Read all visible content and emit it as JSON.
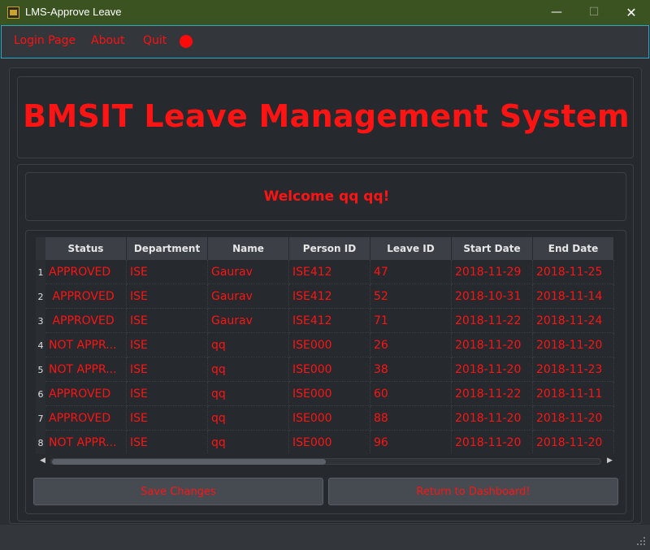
{
  "window": {
    "title": "LMS-Approve Leave",
    "minimize_glyph": "—",
    "maximize_glyph": "☐",
    "close_glyph": "✕"
  },
  "menu": {
    "items": [
      "Login Page",
      "About",
      "Quit"
    ],
    "indicator_color": "#ff0a0a"
  },
  "banner": {
    "title": "BMSIT Leave Management System"
  },
  "welcome": {
    "text": "Welcome qq qq!"
  },
  "table": {
    "columns": [
      "Status",
      "Department",
      "Name",
      "Person ID",
      "Leave ID",
      "Start Date",
      "End Date"
    ],
    "rows": [
      {
        "num": "1",
        "status": "APPROVED",
        "department": "ISE",
        "name": "Gaurav",
        "person_id": "ISE412",
        "leave_id": "47",
        "start_date": "2018-11-29",
        "end_date": "2018-11-25"
      },
      {
        "num": "2",
        "status": " APPROVED",
        "department": "ISE",
        "name": "Gaurav",
        "person_id": "ISE412",
        "leave_id": "52",
        "start_date": "2018-10-31",
        "end_date": "2018-11-14"
      },
      {
        "num": "3",
        "status": " APPROVED",
        "department": "ISE",
        "name": "Gaurav",
        "person_id": "ISE412",
        "leave_id": "71",
        "start_date": "2018-11-22",
        "end_date": "2018-11-24"
      },
      {
        "num": "4",
        "status": "NOT APPR...",
        "department": "ISE",
        "name": "qq",
        "person_id": "ISE000",
        "leave_id": "26",
        "start_date": "2018-11-20",
        "end_date": "2018-11-20"
      },
      {
        "num": "5",
        "status": "NOT APPR...",
        "department": "ISE",
        "name": "qq",
        "person_id": "ISE000",
        "leave_id": "38",
        "start_date": "2018-11-20",
        "end_date": "2018-11-23"
      },
      {
        "num": "6",
        "status": "APPROVED",
        "department": "ISE",
        "name": "qq",
        "person_id": "ISE000",
        "leave_id": "60",
        "start_date": "2018-11-22",
        "end_date": "2018-11-11"
      },
      {
        "num": "7",
        "status": "APPROVED",
        "department": "ISE",
        "name": "qq",
        "person_id": "ISE000",
        "leave_id": "88",
        "start_date": "2018-11-20",
        "end_date": "2018-11-20"
      },
      {
        "num": "8",
        "status": "NOT APPR...",
        "department": "ISE",
        "name": "qq",
        "person_id": "ISE000",
        "leave_id": "96",
        "start_date": "2018-11-20",
        "end_date": "2018-11-20"
      }
    ]
  },
  "scrollbar": {
    "left_glyph": "◀",
    "right_glyph": "▶"
  },
  "buttons": {
    "save": "Save Changes",
    "return": "Return to Dashboard!"
  },
  "colors": {
    "accent_text": "#ff1414",
    "title_bar": "#3b5321",
    "menu_border": "#2aa8c8",
    "background": "#26292d"
  },
  "icons": {
    "app": "briefcase-icon",
    "record": "record-dot-icon"
  }
}
